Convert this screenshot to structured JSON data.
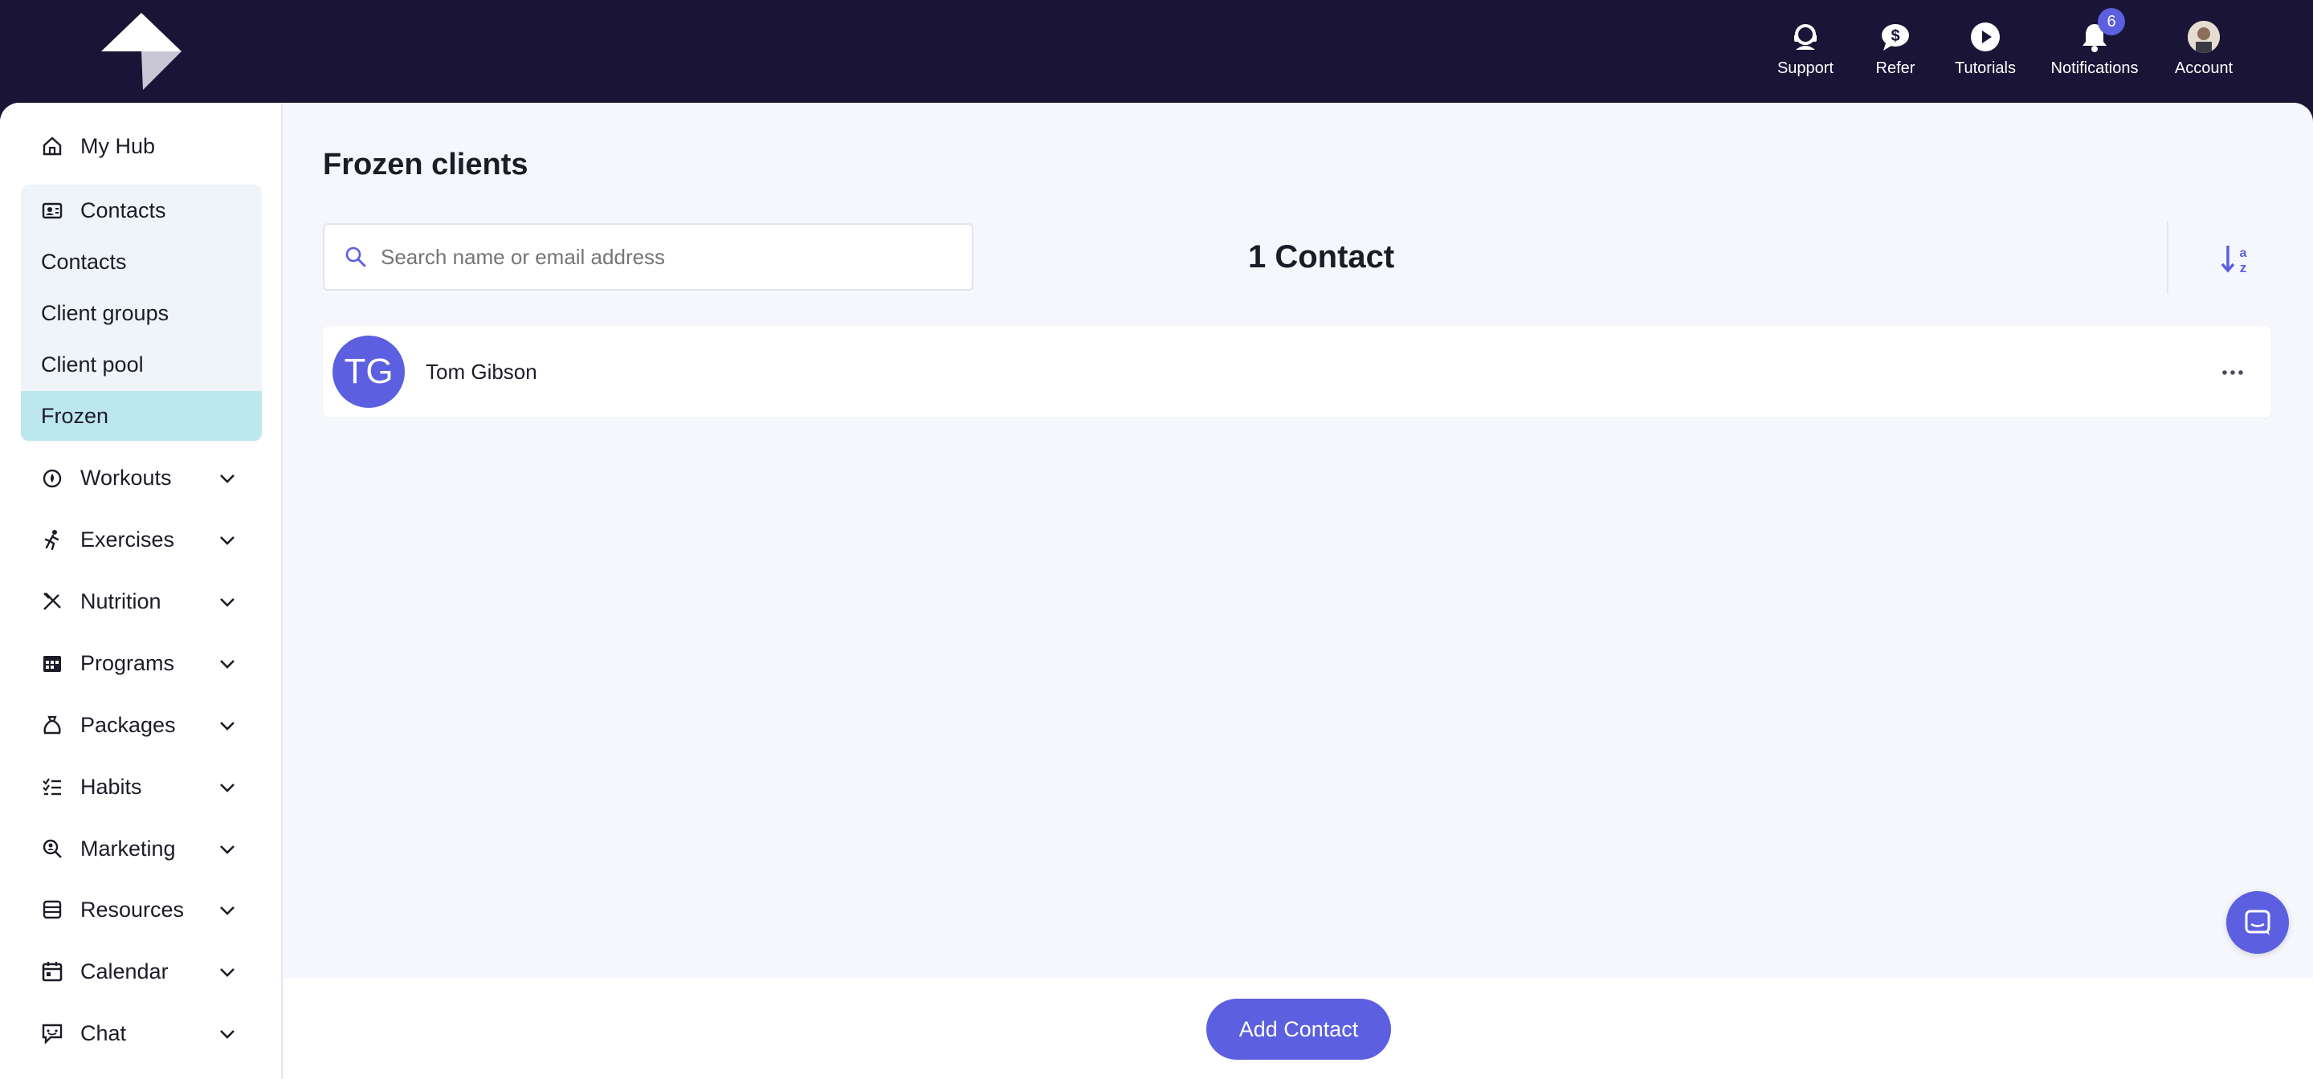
{
  "top_nav": {
    "items": [
      {
        "label": "Support",
        "icon": "support-icon"
      },
      {
        "label": "Refer",
        "icon": "refer-dollar-icon"
      },
      {
        "label": "Tutorials",
        "icon": "play-icon"
      },
      {
        "label": "Notifications",
        "icon": "bell-icon",
        "badge": "6"
      },
      {
        "label": "Account",
        "icon": "account-avatar"
      }
    ]
  },
  "sidebar": {
    "items": [
      {
        "label": "My Hub",
        "icon": "home-icon"
      },
      {
        "label": "Contacts",
        "icon": "contacts-icon"
      },
      {
        "label": "Workouts",
        "icon": "workouts-icon"
      },
      {
        "label": "Exercises",
        "icon": "exercises-icon"
      },
      {
        "label": "Nutrition",
        "icon": "nutrition-icon"
      },
      {
        "label": "Programs",
        "icon": "calendar-grid-icon"
      },
      {
        "label": "Packages",
        "icon": "money-bag-icon"
      },
      {
        "label": "Habits",
        "icon": "checklist-icon"
      },
      {
        "label": "Marketing",
        "icon": "search-person-icon"
      },
      {
        "label": "Resources",
        "icon": "resources-icon"
      },
      {
        "label": "Calendar",
        "icon": "calendar-icon"
      },
      {
        "label": "Chat",
        "icon": "chat-icon"
      }
    ],
    "contacts_sub": [
      {
        "label": "Contacts"
      },
      {
        "label": "Client groups"
      },
      {
        "label": "Client pool"
      },
      {
        "label": "Frozen"
      }
    ]
  },
  "main": {
    "title": "Frozen clients",
    "search_placeholder": "Search name or email address",
    "count_label": "1 Contact",
    "rows": [
      {
        "initials": "TG",
        "name": "Tom Gibson"
      }
    ],
    "add_button": "Add Contact"
  },
  "colors": {
    "accent": "#5b5fe0",
    "topbar": "#1a1436",
    "active_sub": "#bde7ef"
  }
}
